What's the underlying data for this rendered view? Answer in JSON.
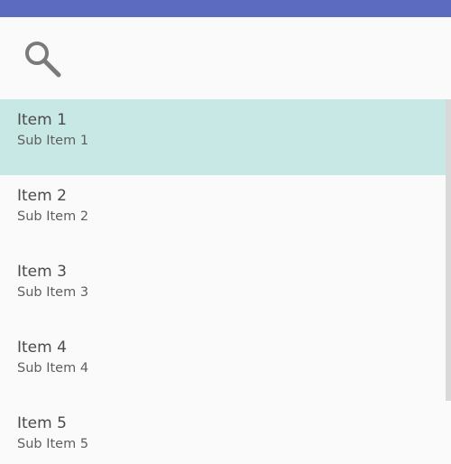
{
  "header": {
    "search_icon": "search-icon"
  },
  "list": {
    "items": [
      {
        "title": "Item 1",
        "subtitle": "Sub Item 1",
        "selected": true
      },
      {
        "title": "Item 2",
        "subtitle": "Sub Item 2",
        "selected": false
      },
      {
        "title": "Item 3",
        "subtitle": "Sub Item 3",
        "selected": false
      },
      {
        "title": "Item 4",
        "subtitle": "Sub Item 4",
        "selected": false
      },
      {
        "title": "Item 5",
        "subtitle": "Sub Item 5",
        "selected": false
      }
    ]
  },
  "colors": {
    "app_bar": "#5c6bc0",
    "selected_row": "#c8e8e5",
    "background": "#fafafa",
    "text_primary": "#4a4a4a",
    "icon": "#7a7a7a"
  }
}
